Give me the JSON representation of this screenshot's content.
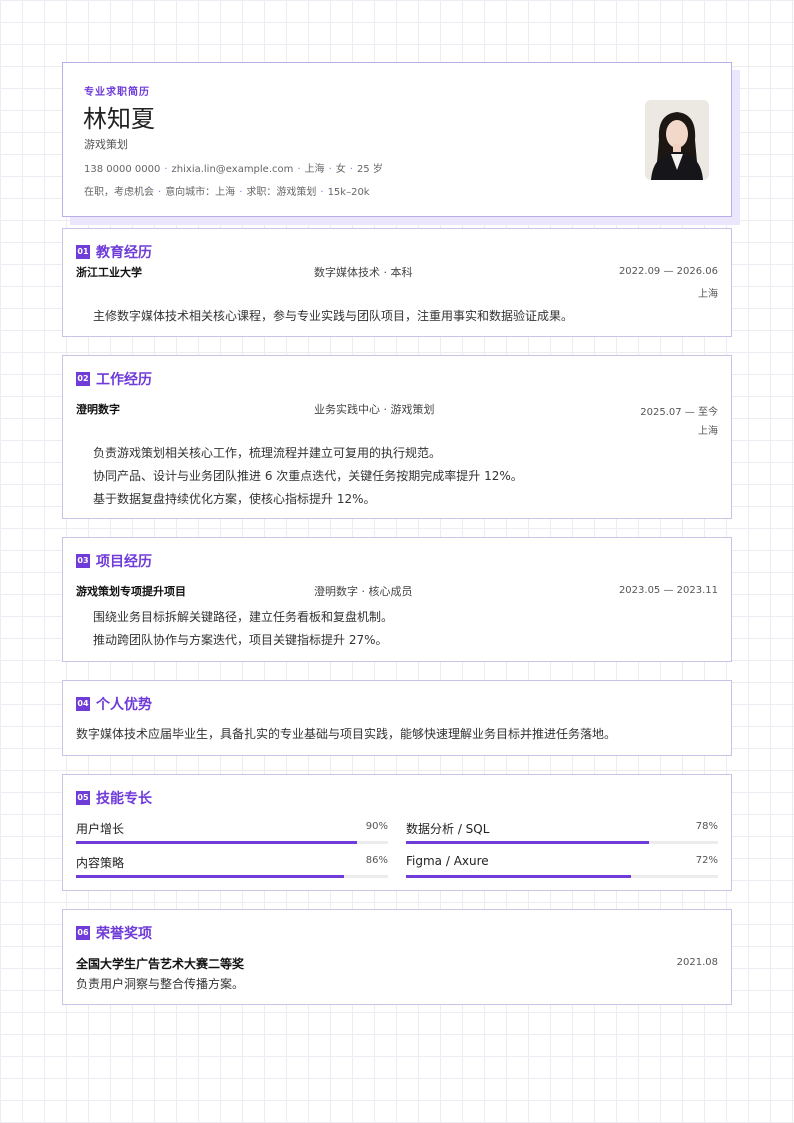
{
  "header": {
    "kicker": "专业求职简历",
    "name": "林知夏",
    "role": "游戏策划",
    "phone": "138 0000 0000",
    "email": "zhixia.lin@example.com",
    "city": "上海",
    "gender": "女",
    "age": "25 岁",
    "status": "在职，考虑机会",
    "target_city": "意向城市：上海",
    "target_role": "求职：游戏策划",
    "salary": "15k–20k"
  },
  "education": {
    "num": "01",
    "title": "教育经历",
    "school": "浙江工业大学",
    "major": "数字媒体技术 · 本科",
    "period": "2022.09 — 2026.06",
    "location": "上海",
    "desc": "主修数字媒体技术相关核心课程，参与专业实践与团队项目，注重用事实和数据验证成果。"
  },
  "work": {
    "num": "02",
    "title": "工作经历",
    "company": "澄明数字",
    "dept": "业务实践中心 · 游戏策划",
    "period": "2025.07 — 至今",
    "location": "上海",
    "bullets": [
      "负责游戏策划相关核心工作，梳理流程并建立可复用的执行规范。",
      "协同产品、设计与业务团队推进 6 次重点迭代，关键任务按期完成率提升 12%。",
      "基于数据复盘持续优化方案，使核心指标提升 12%。"
    ]
  },
  "project": {
    "num": "03",
    "title": "项目经历",
    "name": "游戏策划专项提升项目",
    "org": "澄明数字 · 核心成员",
    "period": "2023.05 — 2023.11",
    "bullets": [
      "围绕业务目标拆解关键路径，建立任务看板和复盘机制。",
      "推动跨团队协作与方案迭代，项目关键指标提升 27%。"
    ]
  },
  "strength": {
    "num": "04",
    "title": "个人优势",
    "text": "数字媒体技术应届毕业生，具备扎实的专业基础与项目实践，能够快速理解业务目标并推进任务落地。"
  },
  "skills": {
    "num": "05",
    "title": "技能专长",
    "items": [
      {
        "name": "用户增长",
        "pct": "90%",
        "value": 0.9
      },
      {
        "name": "数据分析 / SQL",
        "pct": "78%",
        "value": 0.78
      },
      {
        "name": "内容策略",
        "pct": "86%",
        "value": 0.86
      },
      {
        "name": "Figma / Axure",
        "pct": "72%",
        "value": 0.72
      }
    ]
  },
  "honors": {
    "num": "06",
    "title": "荣誉奖项",
    "award": "全国大学生广告艺术大赛二等奖",
    "date": "2021.08",
    "desc": "负责用户洞察与整合传播方案。"
  },
  "colors": {
    "accent": "#6f3bd9",
    "border": "#c9c3e6"
  }
}
